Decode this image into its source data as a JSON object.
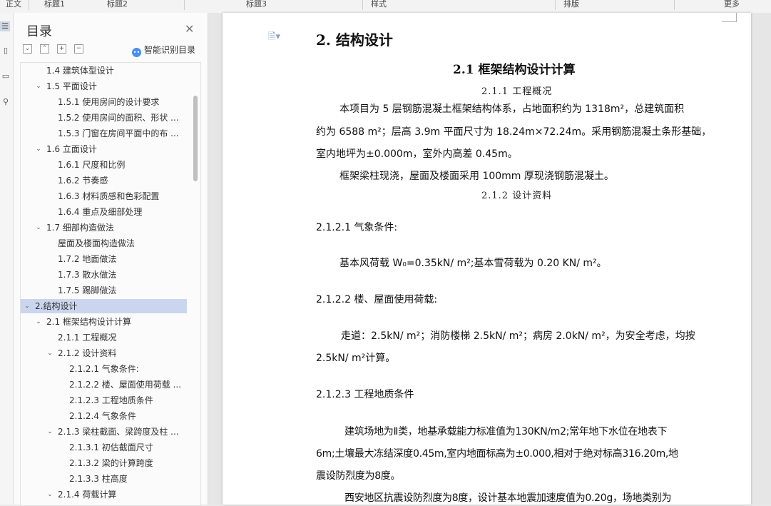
{
  "toolbar": {
    "items": [
      "正文",
      "标题1",
      "标题2",
      "标题3",
      "样式",
      "排版",
      "更多"
    ]
  },
  "toc": {
    "title": "目录",
    "close_icon": "close-icon",
    "smart_label": "智能识别目录",
    "items": [
      {
        "label": "1.4  建筑体型设计",
        "level": 2,
        "arrow": ""
      },
      {
        "label": "1.5  平面设计",
        "level": 2,
        "arrow": "down"
      },
      {
        "label": "1.5.1 使用房间的设计要求",
        "level": 3,
        "arrow": ""
      },
      {
        "label": "1.5.2  使用房间的面积、形状 ...",
        "level": 3,
        "arrow": ""
      },
      {
        "label": "1.5.3  门窗在房间平面中的布 ...",
        "level": 3,
        "arrow": ""
      },
      {
        "label": "1.6  立面设计",
        "level": 2,
        "arrow": "down"
      },
      {
        "label": "1.6.1  尺度和比例",
        "level": 3,
        "arrow": ""
      },
      {
        "label": "1.6.2  节奏感",
        "level": 3,
        "arrow": ""
      },
      {
        "label": "1.6.3  材料质感和色彩配置",
        "level": 3,
        "arrow": ""
      },
      {
        "label": "1.6.4  重点及细部处理",
        "level": 3,
        "arrow": ""
      },
      {
        "label": "1.7  细部构造做法",
        "level": 2,
        "arrow": "down"
      },
      {
        "label": "屋面及楼面构造做法",
        "level": 3,
        "arrow": ""
      },
      {
        "label": "1.7.2  地面做法",
        "level": 3,
        "arrow": ""
      },
      {
        "label": "1.7.3    散水做法",
        "level": 3,
        "arrow": ""
      },
      {
        "label": "1.7.5  踢脚做法",
        "level": 3,
        "arrow": ""
      },
      {
        "label": "2.结构设计",
        "level": 1,
        "arrow": "down",
        "selected": true
      },
      {
        "label": "2.1  框架结构设计计算",
        "level": 2,
        "arrow": "down"
      },
      {
        "label": "2.1.1  工程概况",
        "level": 3,
        "arrow": ""
      },
      {
        "label": "2.1.2  设计资料",
        "level": 3,
        "arrow": "down"
      },
      {
        "label": "2.1.2.1 气象条件:",
        "level": 4,
        "arrow": ""
      },
      {
        "label": "2.1.2.2 楼、屋面使用荷载 ...",
        "level": 4,
        "arrow": ""
      },
      {
        "label": "2.1.2.3  工程地质条件",
        "level": 4,
        "arrow": ""
      },
      {
        "label": "2.1.2.4  气象条件",
        "level": 4,
        "arrow": ""
      },
      {
        "label": "2.1.3  梁柱截面、梁跨度及柱 ...",
        "level": 3,
        "arrow": "down"
      },
      {
        "label": "2.1.3.1  初估截面尺寸",
        "level": 4,
        "arrow": ""
      },
      {
        "label": "2.1.3.2  梁的计算跨度",
        "level": 4,
        "arrow": ""
      },
      {
        "label": "2.1.3.3  柱高度",
        "level": 4,
        "arrow": ""
      },
      {
        "label": "2.1.4  荷载计算",
        "level": 3,
        "arrow": "down"
      }
    ]
  },
  "doc": {
    "chapter_title": "2. 结构设计",
    "section_title": "2.1 框架结构设计计算",
    "sub_title_1": "2.1.1  工程概况",
    "para_1_line_1": "本项目为 5 层钢筋混凝土框架结构体系，占地面积约为 1318m²，总建筑面积",
    "para_1_line_2": "约为 6588 m²；层高 3.9m 平面尺寸为 18.24m×72.24m。采用钢筋混凝土条形基础，",
    "para_1_line_3": "室内地坪为±0.000m，室外内高差 0.45m。",
    "para_2": "框架梁柱现浇，屋面及楼面采用 100mm 厚现浇钢筋混凝土。",
    "sub_title_2": "2.1.2  设计资料",
    "h_2121": "2.1.2.1 气象条件:",
    "wind_snow": "基本风荷载 W₀=0.35kN/ m²;基本雪荷载为 0.20 KN/ m²。",
    "h_2122": "2.1.2.2 楼、屋面使用荷载:",
    "loads_line_1": "走道：2.5kN/ m²；消防楼梯 2.5kN/ m²；病房 2.0kN/ m²，为安全考虑，均按",
    "loads_line_2": "2.5kN/ m²计算。",
    "h_2123": "2.1.2.3  工程地质条件",
    "geo_line_1": "建筑场地为Ⅱ类，地基承载能力标准值为130KN/m2;常年地下水位在地表下",
    "geo_line_2": "6m;土壤最大冻结深度0.45m,室内地面标高为±0.000,相对于绝对标高316.20m,地",
    "geo_line_3": "震设防烈度为8度。",
    "quake_line": "西安地区抗震设防烈度为8度，设计基本地震加速度值为0.20g，场地类别为"
  }
}
